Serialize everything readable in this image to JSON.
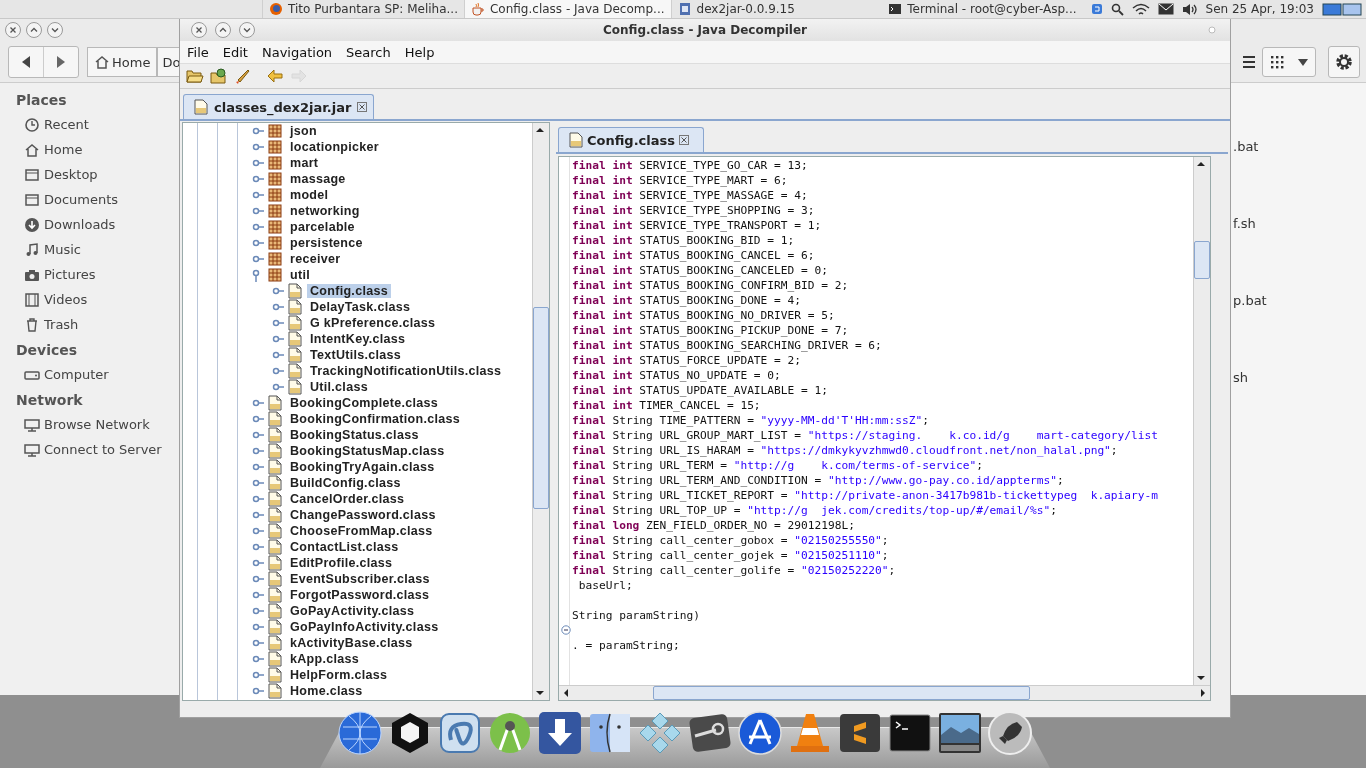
{
  "top_panel": {
    "tasks": [
      {
        "label": "Tito Purbantara SP: Meliha...",
        "kind": "browser",
        "selected": false
      },
      {
        "label": "Config.class - Java Decomp...",
        "kind": "java",
        "selected": true
      },
      {
        "label": "dex2jar-0.0.9.15",
        "kind": "document",
        "selected": false
      },
      {
        "label": "Terminal - root@cyber-Asp...",
        "kind": "terminal",
        "selected": false
      }
    ],
    "clock": "Sen 25 Apr, 19:03"
  },
  "file_manager": {
    "path": [
      "Home",
      "Do"
    ],
    "sidebar": [
      {
        "heading": "Places",
        "items": [
          {
            "label": "Recent",
            "kind": "clock"
          },
          {
            "label": "Home",
            "kind": "home"
          },
          {
            "label": "Desktop",
            "kind": "folder"
          },
          {
            "label": "Documents",
            "kind": "folder"
          },
          {
            "label": "Downloads",
            "kind": "download"
          },
          {
            "label": "Music",
            "kind": "music"
          },
          {
            "label": "Pictures",
            "kind": "camera"
          },
          {
            "label": "Videos",
            "kind": "film"
          },
          {
            "label": "Trash",
            "kind": "trash"
          }
        ]
      },
      {
        "heading": "Devices",
        "items": [
          {
            "label": "Computer",
            "kind": "drive"
          }
        ]
      },
      {
        "heading": "Network",
        "items": [
          {
            "label": "Browse Network",
            "kind": "network"
          },
          {
            "label": "Connect to Server",
            "kind": "network"
          }
        ]
      }
    ],
    "files": [
      ".bat",
      "f.sh",
      "p.bat",
      "sh"
    ]
  },
  "window": {
    "title": "Config.class - Java Decompiler",
    "menu": [
      "File",
      "Edit",
      "Navigation",
      "Search",
      "Help"
    ],
    "toolbar": [
      {
        "kind": "open",
        "disabled": false
      },
      {
        "kind": "open-type",
        "disabled": false
      },
      {
        "kind": "rocket",
        "disabled": false
      },
      {
        "kind": "back",
        "disabled": false
      },
      {
        "kind": "forward",
        "disabled": true
      }
    ],
    "archive_tab": {
      "label": "classes_dex2jar.jar"
    },
    "tree": [
      {
        "label": "json",
        "kind": "package",
        "expanded": false,
        "selected": false
      },
      {
        "label": "locationpicker",
        "kind": "package",
        "expanded": false,
        "selected": false
      },
      {
        "label": "mart",
        "kind": "package",
        "expanded": false,
        "selected": false
      },
      {
        "label": "massage",
        "kind": "package",
        "expanded": false,
        "selected": false
      },
      {
        "label": "model",
        "kind": "package",
        "expanded": false,
        "selected": false
      },
      {
        "label": "networking",
        "kind": "package",
        "expanded": false,
        "selected": false
      },
      {
        "label": "parcelable",
        "kind": "package",
        "expanded": false,
        "selected": false
      },
      {
        "label": "persistence",
        "kind": "package",
        "expanded": false,
        "selected": false
      },
      {
        "label": "receiver",
        "kind": "package",
        "expanded": false,
        "selected": false
      },
      {
        "label": "util",
        "kind": "package",
        "expanded": true,
        "selected": false,
        "children": [
          {
            "label": "Config.class",
            "kind": "class",
            "expanded": false,
            "selected": true
          },
          {
            "label": "DelayTask.class",
            "kind": "class",
            "expanded": false,
            "selected": false
          },
          {
            "label": "G    kPreference.class",
            "kind": "class",
            "expanded": false,
            "selected": false
          },
          {
            "label": "IntentKey.class",
            "kind": "class",
            "expanded": false,
            "selected": false
          },
          {
            "label": "TextUtils.class",
            "kind": "class",
            "expanded": false,
            "selected": false
          },
          {
            "label": "TrackingNotificationUtils.class",
            "kind": "class",
            "expanded": false,
            "selected": false
          },
          {
            "label": "Util.class",
            "kind": "class",
            "expanded": false,
            "selected": false
          }
        ]
      },
      {
        "label": "BookingComplete.class",
        "kind": "class",
        "expanded": false,
        "selected": false
      },
      {
        "label": "BookingConfirmation.class",
        "kind": "class",
        "expanded": false,
        "selected": false
      },
      {
        "label": "BookingStatus.class",
        "kind": "class",
        "expanded": false,
        "selected": false
      },
      {
        "label": "BookingStatusMap.class",
        "kind": "class",
        "expanded": false,
        "selected": false
      },
      {
        "label": "BookingTryAgain.class",
        "kind": "class",
        "expanded": false,
        "selected": false
      },
      {
        "label": "BuildConfig.class",
        "kind": "class",
        "expanded": false,
        "selected": false
      },
      {
        "label": "CancelOrder.class",
        "kind": "class",
        "expanded": false,
        "selected": false
      },
      {
        "label": "ChangePassword.class",
        "kind": "class",
        "expanded": false,
        "selected": false
      },
      {
        "label": "ChooseFromMap.class",
        "kind": "class",
        "expanded": false,
        "selected": false
      },
      {
        "label": "ContactList.class",
        "kind": "class",
        "expanded": false,
        "selected": false
      },
      {
        "label": "EditProfile.class",
        "kind": "class",
        "expanded": false,
        "selected": false
      },
      {
        "label": "EventSubscriber.class",
        "kind": "class",
        "expanded": false,
        "selected": false
      },
      {
        "label": "ForgotPassword.class",
        "kind": "class",
        "expanded": false,
        "selected": false
      },
      {
        "label": "GoPayActivity.class",
        "kind": "class",
        "expanded": false,
        "selected": false
      },
      {
        "label": "GoPayInfoActivity.class",
        "kind": "class",
        "expanded": false,
        "selected": false
      },
      {
        "label": "kActivityBase.class",
        "kind": "class",
        "expanded": false,
        "selected": false
      },
      {
        "label": "kApp.class",
        "kind": "class",
        "expanded": false,
        "selected": false
      },
      {
        "label": "HelpForm.class",
        "kind": "class",
        "expanded": false,
        "selected": false
      },
      {
        "label": "Home.class",
        "kind": "class",
        "expanded": false,
        "selected": false
      }
    ],
    "editor_tab": {
      "label": "Config.class"
    },
    "code": [
      {
        "kind": "code",
        "keyword": "final int",
        "code": " SERVICE_TYPE_GO_CAR = 13;"
      },
      {
        "kind": "code",
        "keyword": "final int",
        "code": " SERVICE_TYPE_MART = 6;"
      },
      {
        "kind": "code",
        "keyword": "final int",
        "code": " SERVICE_TYPE_MASSAGE = 4;"
      },
      {
        "kind": "code",
        "keyword": "final int",
        "code": " SERVICE_TYPE_SHOPPING = 3;"
      },
      {
        "kind": "code",
        "keyword": "final int",
        "code": " SERVICE_TYPE_TRANSPORT = 1;"
      },
      {
        "kind": "code",
        "keyword": "final int",
        "code": " STATUS_BOOKING_BID = 1;"
      },
      {
        "kind": "code",
        "keyword": "final int",
        "code": " STATUS_BOOKING_CANCEL = 6;"
      },
      {
        "kind": "code",
        "keyword": "final int",
        "code": " STATUS_BOOKING_CANCELED = 0;"
      },
      {
        "kind": "code",
        "keyword": "final int",
        "code": " STATUS_BOOKING_CONFIRM_BID = 2;"
      },
      {
        "kind": "code",
        "keyword": "final int",
        "code": " STATUS_BOOKING_DONE = 4;"
      },
      {
        "kind": "code",
        "keyword": "final int",
        "code": " STATUS_BOOKING_NO_DRIVER = 5;"
      },
      {
        "kind": "code",
        "keyword": "final int",
        "code": " STATUS_BOOKING_PICKUP_DONE = 7;"
      },
      {
        "kind": "code",
        "keyword": "final int",
        "code": " STATUS_BOOKING_SEARCHING_DRIVER = 6;"
      },
      {
        "kind": "code",
        "keyword": "final int",
        "code": " STATUS_FORCE_UPDATE = 2;"
      },
      {
        "kind": "code",
        "keyword": "final int",
        "code": " STATUS_NO_UPDATE = 0;"
      },
      {
        "kind": "code",
        "keyword": "final int",
        "code": " STATUS_UPDATE_AVAILABLE = 1;"
      },
      {
        "kind": "code",
        "keyword": "final int",
        "code": " TIMER_CANCEL = 15;"
      },
      {
        "kind": "code",
        "keyword": "final",
        "code": " String TIME_PATTERN = ",
        "literal": "\"yyyy-MM-dd'T'HH:mm:ssZ\"",
        "tail": ";"
      },
      {
        "kind": "code",
        "keyword": "final",
        "code": " String URL_GROUP_MART_LIST = ",
        "literal": "\"https://staging.    k.co.id/g    mart-category/list"
      },
      {
        "kind": "code",
        "keyword": "final",
        "code": " String URL_IS_HARAM = ",
        "literal": "\"https://dmkykyvzhmwd0.cloudfront.net/non_halal.png\"",
        "tail": ";"
      },
      {
        "kind": "code",
        "keyword": "final",
        "code": " String URL_TERM = ",
        "literal": "\"http://g    k.com/terms-of-service\"",
        "tail": ";"
      },
      {
        "kind": "code",
        "keyword": "final",
        "code": " String URL_TERM_AND_CONDITION = ",
        "literal": "\"http://www.go-pay.co.id/appterms\"",
        "tail": ";"
      },
      {
        "kind": "code",
        "keyword": "final",
        "code": " String URL_TICKET_REPORT = ",
        "literal": "\"http://private-anon-3417b981b-tickettypeg  k.apiary-m"
      },
      {
        "kind": "code",
        "keyword": "final",
        "code": " String URL_TOP_UP = ",
        "literal": "\"http://g  jek.com/credits/top-up/#/email/%s\"",
        "tail": ";"
      },
      {
        "kind": "code",
        "keyword": "final long",
        "code": " ZEN_FIELD_ORDER_NO = 29012198L;"
      },
      {
        "kind": "code",
        "keyword": "final",
        "code": " String call_center_gobox = ",
        "literal": "\"02150255550\"",
        "tail": ";"
      },
      {
        "kind": "code",
        "keyword": "final",
        "code": " String call_center_gojek = ",
        "literal": "\"02150251110\"",
        "tail": ";"
      },
      {
        "kind": "code",
        "keyword": "final",
        "code": " String call_center_golife = ",
        "literal": "\"02150252220\"",
        "tail": ";"
      },
      {
        "kind": "code",
        "code": " baseUrl;"
      },
      {
        "kind": "blank"
      },
      {
        "kind": "code",
        "code": "String paramString)"
      },
      {
        "kind": "fold"
      },
      {
        "kind": "code",
        "code": ". = paramString;"
      }
    ]
  }
}
